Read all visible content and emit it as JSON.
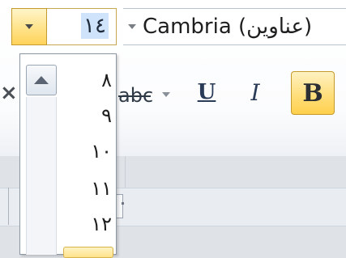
{
  "font_size_combo": {
    "value": "١٤",
    "dropdown_open": true
  },
  "font_name_combo": {
    "value": "Cambria (عناوين)"
  },
  "font_size_list": {
    "items": [
      "٨",
      "٩",
      "١٠",
      "١١",
      "١٢"
    ]
  },
  "formatting": {
    "bold": "B",
    "italic": "I",
    "underline": "U",
    "strikethrough": "abc"
  },
  "icons": {
    "size_dropdown": "chevron-down-icon",
    "font_dropdown": "chevron-down-icon",
    "scroll_up": "arrow-up-icon",
    "clear_format": "x-icon"
  },
  "colors": {
    "active_highlight": "#ffd35a",
    "selection": "#cfe3fb"
  }
}
